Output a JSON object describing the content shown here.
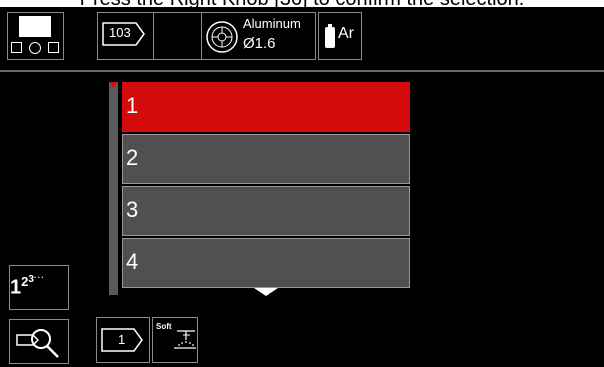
{
  "caption": "Press the Right Knob [36] to confirm the selection.",
  "header": {
    "wire_feed_value": "103",
    "wire_material": "Aluminum",
    "wire_diameter": "Ø1.6",
    "gas": "Ar"
  },
  "memory_list": {
    "items": [
      {
        "label": "1",
        "selected": true
      },
      {
        "label": "2",
        "selected": false
      },
      {
        "label": "3",
        "selected": false
      },
      {
        "label": "4",
        "selected": false
      }
    ]
  },
  "bottom": {
    "memory_slot_value": "1",
    "soft_label": "Soft"
  },
  "colors": {
    "selected": "#d40b0b",
    "item": "#505050",
    "background": "#000000"
  },
  "icons": [
    "layout-icon",
    "wire-feed-icon",
    "wire-spool-icon",
    "gas-cylinder-icon",
    "memory-numbers-icon",
    "search-icon",
    "memory-slot-icon",
    "soft-start-icon",
    "scroll-down-icon"
  ]
}
